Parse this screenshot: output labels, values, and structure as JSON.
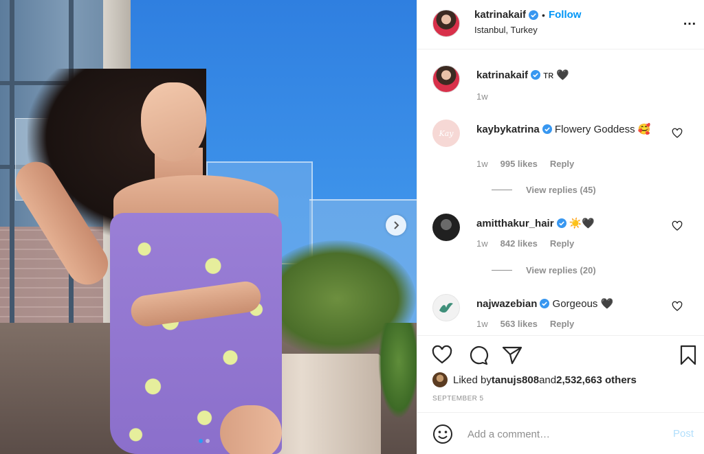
{
  "post": {
    "images_count": 2,
    "current_image": 1
  },
  "header": {
    "username": "katrinakaif",
    "separator": "•",
    "follow_label": "Follow",
    "location": "Istanbul, Turkey",
    "more_icon": "more-options-icon"
  },
  "caption": {
    "username": "katrinakaif",
    "text": "ᴛʀ 🖤",
    "time": "1w"
  },
  "comments": [
    {
      "username": "kaybykatrina",
      "avatar_text": "Kay",
      "text": "Flowery Goddess 🥰",
      "time": "1w",
      "likes": "995 likes",
      "reply_label": "Reply",
      "view_replies": "View replies (45)"
    },
    {
      "username": "amitthakur_hair",
      "text": "☀️🖤",
      "time": "1w",
      "likes": "842 likes",
      "reply_label": "Reply",
      "view_replies": "View replies (20)"
    },
    {
      "username": "najwazebian",
      "text": "Gorgeous 🖤",
      "time": "1w",
      "likes": "563 likes",
      "reply_label": "Reply"
    }
  ],
  "actions": {
    "liked_prefix": "Liked by ",
    "liked_user": "tanujs808",
    "liked_and": " and ",
    "liked_count": "2,532,663 others",
    "date": "SEPTEMBER 5"
  },
  "add_comment": {
    "placeholder": "Add a comment…",
    "post_label": "Post"
  },
  "colors": {
    "link_blue": "#0095f6",
    "secondary_text": "#8e8e8e",
    "border": "#efefef",
    "post_disabled": "#b2dffc"
  }
}
